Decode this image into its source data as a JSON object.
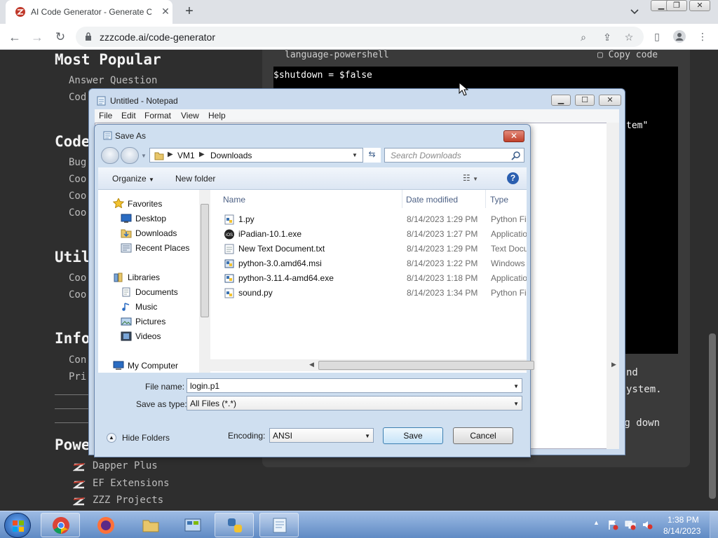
{
  "browser": {
    "tab_title": "AI Code Generator - Generate Co",
    "url": "zzzcode.ai/code-generator"
  },
  "page": {
    "sidebar": {
      "sections": [
        {
          "title": "Most Popular",
          "items": [
            "Answer Question",
            "Cod"
          ]
        },
        {
          "title": "Code",
          "items": [
            "Bug",
            "Coo",
            "Coo",
            "Coo"
          ]
        },
        {
          "title": "Util",
          "items": [
            "Coo",
            "Coo"
          ]
        },
        {
          "title": "Info",
          "items": [
            "Con",
            "Pri"
          ]
        },
        {
          "title": "Powe",
          "items": []
        }
      ],
      "powered_by": [
        "Dapper Plus",
        "EF Extensions",
        "ZZZ Projects"
      ]
    },
    "code": {
      "language_label": "language-powershell",
      "copy_label": "Copy code",
      "line1": "$shutdown = $false",
      "fragment": "tem\""
    },
    "description_fragments": [
      "nd",
      "ystem.",
      "ng down"
    ]
  },
  "notepad": {
    "title": "Untitled - Notepad",
    "menu": [
      "File",
      "Edit",
      "Format",
      "View",
      "Help"
    ]
  },
  "save_as": {
    "title": "Save As",
    "breadcrumbs": [
      "VM1",
      "Downloads"
    ],
    "search_placeholder": "Search Downloads",
    "organize_label": "Organize",
    "new_folder_label": "New folder",
    "nav": {
      "favorites_label": "Favorites",
      "favorites": [
        "Desktop",
        "Downloads",
        "Recent Places"
      ],
      "libraries_label": "Libraries",
      "libraries": [
        "Documents",
        "Music",
        "Pictures",
        "Videos"
      ],
      "computer_label": "My Computer"
    },
    "columns": [
      "Name",
      "Date modified",
      "Type"
    ],
    "files": [
      {
        "name": "1.py",
        "date": "8/14/2023 1:29 PM",
        "type": "Python Fi",
        "icon": "python-file"
      },
      {
        "name": "iPadian-10.1.exe",
        "date": "8/14/2023 1:27 PM",
        "type": "Applicatio",
        "icon": "ios-app"
      },
      {
        "name": "New Text Document.txt",
        "date": "8/14/2023 1:29 PM",
        "type": "Text Docu",
        "icon": "text-file"
      },
      {
        "name": "python-3.0.amd64.msi",
        "date": "8/14/2023 1:22 PM",
        "type": "Windows",
        "icon": "msi-installer"
      },
      {
        "name": "python-3.11.4-amd64.exe",
        "date": "8/14/2023 1:18 PM",
        "type": "Applicatio",
        "icon": "python-installer"
      },
      {
        "name": "sound.py",
        "date": "8/14/2023 1:34 PM",
        "type": "Python Fi",
        "icon": "python-file"
      }
    ],
    "file_name_label": "File name:",
    "file_name_value": "login.p1",
    "save_as_type_label": "Save as type:",
    "save_as_type_value": "All Files  (*.*)",
    "encoding_label": "Encoding:",
    "encoding_value": "ANSI",
    "hide_folders_label": "Hide Folders",
    "save_label": "Save",
    "cancel_label": "Cancel"
  },
  "taskbar": {
    "time": "1:38 PM",
    "date": "8/14/2023"
  }
}
